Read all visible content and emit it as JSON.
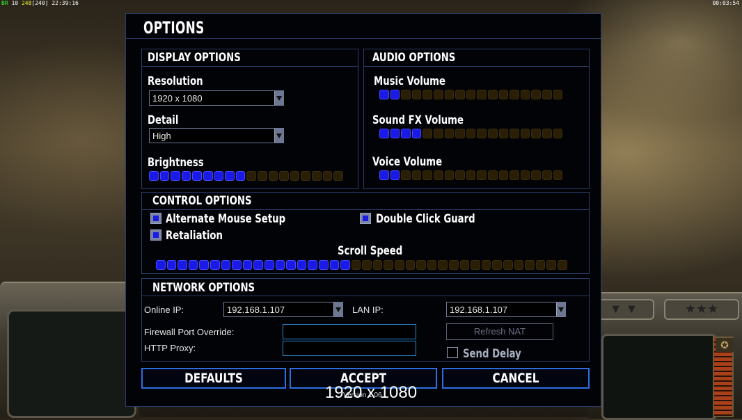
{
  "hud": {
    "left_prefix": "BR",
    "left_a": "10",
    "left_b": "248",
    "left_c": "[240]",
    "left_time": "22:39:16",
    "right_time": "00:03:54"
  },
  "dialog": {
    "title": "OPTIONS"
  },
  "display": {
    "title": "DISPLAY OPTIONS",
    "resolution_label": "Resolution",
    "resolution_value": "1920 x 1080",
    "detail_label": "Detail",
    "detail_value": "High",
    "brightness_label": "Brightness",
    "brightness_level": 9,
    "brightness_total": 18
  },
  "audio": {
    "title": "AUDIO OPTIONS",
    "music_label": "Music Volume",
    "music_level": 2,
    "sfx_label": "Sound FX Volume",
    "sfx_level": 4,
    "voice_label": "Voice Volume",
    "voice_level": 2,
    "total": 17
  },
  "control": {
    "title": "CONTROL OPTIONS",
    "alt_mouse_label": "Alternate Mouse Setup",
    "alt_mouse_checked": true,
    "double_click_label": "Double Click Guard",
    "double_click_checked": true,
    "retaliation_label": "Retaliation",
    "retaliation_checked": true,
    "scroll_label": "Scroll Speed",
    "scroll_level": 18,
    "scroll_total": 38
  },
  "network": {
    "title": "NETWORK OPTIONS",
    "online_ip_label": "Online IP:",
    "online_ip_value": "192.168.1.107",
    "lan_ip_label": "LAN IP:",
    "lan_ip_value": "192.168.1.107",
    "firewall_label": "Firewall Port Override:",
    "firewall_value": "",
    "http_proxy_label": "HTTP Proxy:",
    "http_proxy_value": "",
    "refresh_nat_label": "Refresh NAT",
    "send_delay_label": "Send Delay",
    "send_delay_checked": false
  },
  "buttons": {
    "defaults": "DEFAULTS",
    "accept": "ACCEPT",
    "cancel": "CANCEL"
  },
  "version_text": "Version 1.06",
  "overlay_text": "1920 x 1080",
  "colors": {
    "slider_on": "#1a1ae6",
    "slider_off": "#2a1e05",
    "border": "#2c3b6a",
    "button_border": "#2d6fe0"
  }
}
